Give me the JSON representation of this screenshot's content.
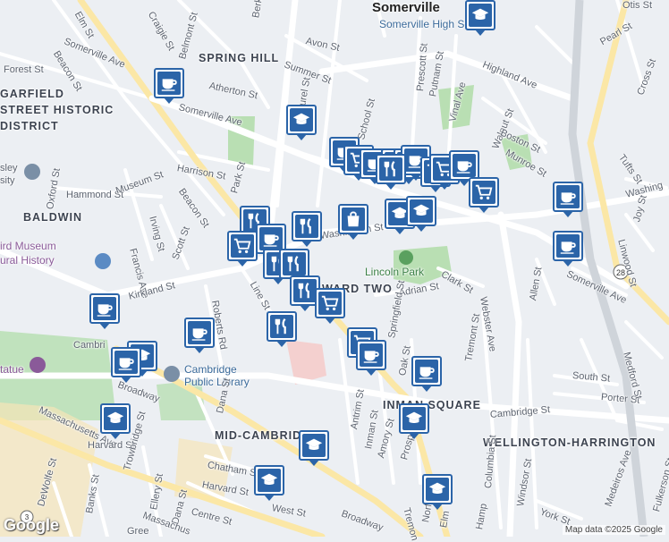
{
  "map": {
    "cities": [
      {
        "id": "somerville",
        "text": "Somerville"
      }
    ],
    "neighborhoods": [
      {
        "id": "spring-hill",
        "text": "SPRING HILL"
      },
      {
        "id": "garfield",
        "text": "GARFIELD"
      },
      {
        "id": "street-historic",
        "text": "STREET HISTORIC"
      },
      {
        "id": "district",
        "text": "DISTRICT"
      },
      {
        "id": "baldwin",
        "text": "BALDWIN"
      },
      {
        "id": "ward-two",
        "text": "WARD TWO"
      },
      {
        "id": "inman-square",
        "text": "INMAN SQUARE"
      },
      {
        "id": "mid-cambridge",
        "text": "MID-CAMBRIDGE"
      },
      {
        "id": "wellington-harrington",
        "text": "WELLINGTON-HARRINGTON"
      }
    ],
    "pois": [
      {
        "id": "somerville-high",
        "text": "Somerville High School"
      },
      {
        "id": "cambridge-library-1",
        "text": "Cambridge"
      },
      {
        "id": "cambridge-library-2",
        "text": "Public Library"
      },
      {
        "id": "museum-1",
        "text": "ird Museum"
      },
      {
        "id": "museum-2",
        "text": "ural History"
      },
      {
        "id": "lesley-1",
        "text": "sley"
      },
      {
        "id": "lesley-2",
        "text": "sity"
      },
      {
        "id": "statue",
        "text": "tatue"
      },
      {
        "id": "lincoln-park",
        "text": "Lincoln Park"
      }
    ],
    "streets": [
      {
        "id": "elm-st",
        "text": "Elm St"
      },
      {
        "id": "craigie-st",
        "text": "Craigie St"
      },
      {
        "id": "belmont-st",
        "text": "Belmont St"
      },
      {
        "id": "beacon-st-n",
        "text": "Beacon St"
      },
      {
        "id": "somerville-ave-w",
        "text": "Somerville Ave"
      },
      {
        "id": "forest-st",
        "text": "Forest St"
      },
      {
        "id": "avon-st",
        "text": "Avon St"
      },
      {
        "id": "summer-st",
        "text": "Summer St"
      },
      {
        "id": "atherton-st",
        "text": "Atherton St"
      },
      {
        "id": "laurel-st",
        "text": "Laurel St"
      },
      {
        "id": "berkeley-st",
        "text": "Berke"
      },
      {
        "id": "prescott-st",
        "text": "Prescott St"
      },
      {
        "id": "putnam-st",
        "text": "Putnam St"
      },
      {
        "id": "vinal-ave",
        "text": "Vinal Ave"
      },
      {
        "id": "highland-ave",
        "text": "Highland Ave"
      },
      {
        "id": "pearl-st",
        "text": "Pearl St"
      },
      {
        "id": "cross-st",
        "text": "Cross St"
      },
      {
        "id": "otis-st",
        "text": "Otis St"
      },
      {
        "id": "somerville-ave-c",
        "text": "Somerville Ave"
      },
      {
        "id": "school-st",
        "text": "School St"
      },
      {
        "id": "walnut-st",
        "text": "Walnut St"
      },
      {
        "id": "boston-st",
        "text": "Boston St"
      },
      {
        "id": "munroe-st",
        "text": "Munroe St"
      },
      {
        "id": "tufts-st",
        "text": "Tufts St"
      },
      {
        "id": "harrison-st",
        "text": "Harrison St"
      },
      {
        "id": "park-st",
        "text": "Park St"
      },
      {
        "id": "beacon-st-c",
        "text": "Beacon St"
      },
      {
        "id": "hammond-st",
        "text": "Hammond St"
      },
      {
        "id": "museum-st",
        "text": "Museum St"
      },
      {
        "id": "oxford-st",
        "text": "Oxford St"
      },
      {
        "id": "irving-st",
        "text": "Irving St"
      },
      {
        "id": "francis-ave",
        "text": "Francis Ave"
      },
      {
        "id": "scott-st",
        "text": "Scott St"
      },
      {
        "id": "washington-st",
        "text": "Washington St"
      },
      {
        "id": "washington-st-e",
        "text": "Washing"
      },
      {
        "id": "joy-st",
        "text": "Joy St"
      },
      {
        "id": "somerville-ave-e",
        "text": "Somerville Ave"
      },
      {
        "id": "linwood-st",
        "text": "Linwood St"
      },
      {
        "id": "allen-st",
        "text": "Allen St"
      },
      {
        "id": "clark-st",
        "text": "Clark St"
      },
      {
        "id": "adrian-st",
        "text": "Adrian St"
      },
      {
        "id": "webster-ave",
        "text": "Webster Ave"
      },
      {
        "id": "kirkland-st",
        "text": "Kirkland St"
      },
      {
        "id": "line-st",
        "text": "Line St"
      },
      {
        "id": "roberts-rd",
        "text": "Roberts Rd"
      },
      {
        "id": "cambridge-st-w",
        "text": "Cambri"
      },
      {
        "id": "broadway-w",
        "text": "Broadway"
      },
      {
        "id": "massachusetts-ave",
        "text": "Massachusetts Ave"
      },
      {
        "id": "harvard-st-w",
        "text": "Harvard St"
      },
      {
        "id": "dana-st",
        "text": "Dana St"
      },
      {
        "id": "springfield-st",
        "text": "Springfield St"
      },
      {
        "id": "oak-st",
        "text": "Oak St"
      },
      {
        "id": "tremont-st",
        "text": "Tremont St"
      },
      {
        "id": "south-st",
        "text": "South St"
      },
      {
        "id": "porter-st",
        "text": "Porter St"
      },
      {
        "id": "medford-st",
        "text": "Medford St"
      },
      {
        "id": "cambridge-st-e",
        "text": "Cambridge St"
      },
      {
        "id": "antrim-st",
        "text": "Antrim St"
      },
      {
        "id": "inman-st",
        "text": "Inman St"
      },
      {
        "id": "amory-st",
        "text": "Amory St"
      },
      {
        "id": "prospect-st",
        "text": "Prospe"
      },
      {
        "id": "columbia-st",
        "text": "Columbia St"
      },
      {
        "id": "windsor-st",
        "text": "Windsor St"
      },
      {
        "id": "york-st",
        "text": "York St"
      },
      {
        "id": "fulkerson-st",
        "text": "Fulkerson St"
      },
      {
        "id": "medeiros-ave",
        "text": "Medeiros Ave"
      },
      {
        "id": "trowbridge-st",
        "text": "Trowbridge St"
      },
      {
        "id": "ellery-st",
        "text": "Ellery St"
      },
      {
        "id": "harvard-st-s",
        "text": "Harvard St"
      },
      {
        "id": "chatham-st",
        "text": "Chatham St"
      },
      {
        "id": "dana-st-s",
        "text": "Dana St"
      },
      {
        "id": "centre-st",
        "text": "Centre St"
      },
      {
        "id": "west-st",
        "text": "West St"
      },
      {
        "id": "broadway-s",
        "text": "Broadway"
      },
      {
        "id": "massachusetts-ave-s",
        "text": "Massachus"
      },
      {
        "id": "dewolfe-st",
        "text": "DeWolfe St"
      },
      {
        "id": "banks-st",
        "text": "Banks St"
      },
      {
        "id": "greene-st",
        "text": "Gree"
      },
      {
        "id": "hampshire-st",
        "text": "Hamp"
      },
      {
        "id": "norfolk-st",
        "text": "Norf"
      },
      {
        "id": "elm-st-s",
        "text": "Elm"
      },
      {
        "id": "tremont-st-s",
        "text": "Tremon"
      },
      {
        "id": "route-28",
        "text": "28"
      },
      {
        "id": "route-3",
        "text": "3"
      }
    ],
    "markers": [
      {
        "id": "m1",
        "kind": "school"
      },
      {
        "id": "m2",
        "kind": "coffee"
      },
      {
        "id": "m3",
        "kind": "school"
      },
      {
        "id": "m4",
        "kind": "coffee"
      },
      {
        "id": "m5",
        "kind": "cart"
      },
      {
        "id": "m6",
        "kind": "coffee"
      },
      {
        "id": "m7",
        "kind": "restaurant"
      },
      {
        "id": "m8",
        "kind": "cart"
      },
      {
        "id": "m9",
        "kind": "coffee"
      },
      {
        "id": "m10",
        "kind": "cart"
      },
      {
        "id": "m11",
        "kind": "restaurant"
      },
      {
        "id": "m12",
        "kind": "cart"
      },
      {
        "id": "m13",
        "kind": "coffee"
      },
      {
        "id": "m14",
        "kind": "bag"
      },
      {
        "id": "m15",
        "kind": "school"
      },
      {
        "id": "m16",
        "kind": "school"
      },
      {
        "id": "m17",
        "kind": "coffee"
      },
      {
        "id": "m18",
        "kind": "coffee"
      },
      {
        "id": "m19",
        "kind": "restaurant"
      },
      {
        "id": "m20",
        "kind": "restaurant"
      },
      {
        "id": "m21",
        "kind": "cart"
      },
      {
        "id": "m22",
        "kind": "coffee"
      },
      {
        "id": "m23",
        "kind": "restaurant"
      },
      {
        "id": "m24",
        "kind": "restaurant"
      },
      {
        "id": "m25",
        "kind": "cart"
      },
      {
        "id": "m26",
        "kind": "restaurant"
      },
      {
        "id": "m27",
        "kind": "coffee"
      },
      {
        "id": "m28",
        "kind": "cart"
      },
      {
        "id": "m29",
        "kind": "restaurant"
      },
      {
        "id": "m30",
        "kind": "coffee"
      },
      {
        "id": "m31",
        "kind": "cart"
      },
      {
        "id": "m32",
        "kind": "coffee"
      },
      {
        "id": "m33",
        "kind": "school"
      },
      {
        "id": "m34",
        "kind": "coffee"
      },
      {
        "id": "m35",
        "kind": "coffee"
      },
      {
        "id": "m36",
        "kind": "school"
      },
      {
        "id": "m37",
        "kind": "school"
      },
      {
        "id": "m38",
        "kind": "school"
      },
      {
        "id": "m39",
        "kind": "school"
      },
      {
        "id": "m40",
        "kind": "school"
      }
    ],
    "colors": {
      "marker": "#2b64a8",
      "road": "#ffffff",
      "major_road": "#fbe7a6",
      "park": "#b9dfb3",
      "bg": "#eceff3"
    }
  },
  "attribution": {
    "logo": "Google",
    "text": "Map data ©2025 Google"
  }
}
